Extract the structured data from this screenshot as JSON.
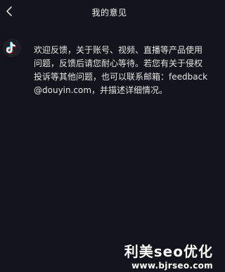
{
  "header": {
    "title": "我的意见",
    "back_icon": "chevron-left-icon"
  },
  "message": {
    "avatar_icon": "tiktok-logo-icon",
    "text": "欢迎反馈，关于账号、视频、直播等产品使用问题，反馈后请您耐心等待。若您有关于侵权投诉等其他问题，也可以联系邮箱：feedback@douyin.com，并描述详细情况。"
  },
  "watermark": {
    "title": "利美seo优化",
    "url": "www.bjrseo.com"
  },
  "colors": {
    "background": "#14141d",
    "text": "#e4e4e4",
    "logo_cyan": "#25f4ee",
    "logo_red": "#fe2c55"
  }
}
